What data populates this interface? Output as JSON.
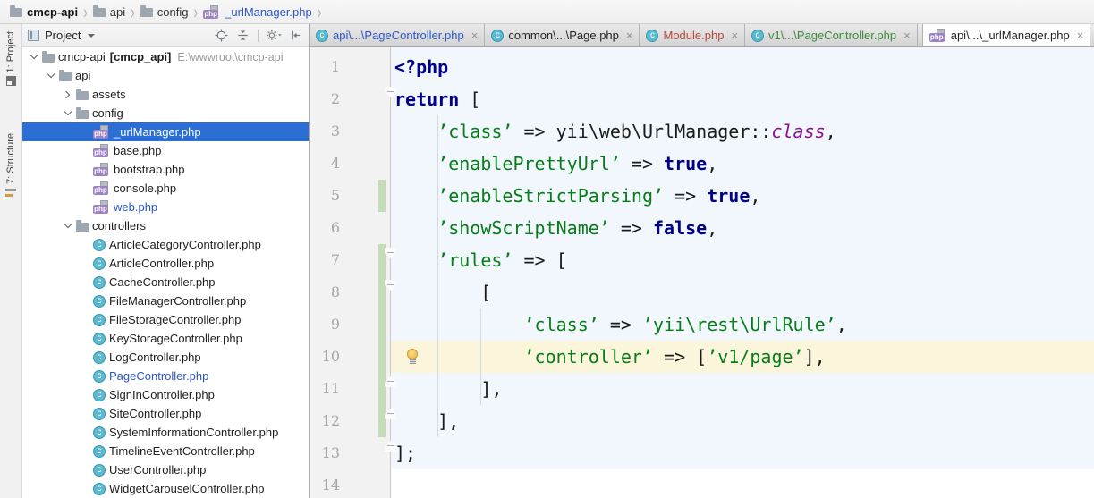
{
  "colors": {
    "selection_blue": "#2B6FD6",
    "modified_blue": "#2B55C8",
    "added_green": "#3F8A3F",
    "conflict_red": "#B5483C",
    "string_green": "#067D17",
    "keyword_navy": "#00008C",
    "class_purple": "#871094",
    "caret_row_yellow": "#FBF5DC",
    "editor_tint_blue": "#F1F7FD",
    "vcs_bar_green": "#C5DCB8"
  },
  "icons": {
    "php_badge": "php",
    "class_letter": "c",
    "close": "×"
  },
  "breadcrumbs": {
    "items": [
      {
        "label": "cmcp-api",
        "icon": "folder",
        "bold": true
      },
      {
        "label": "api",
        "icon": "folder"
      },
      {
        "label": "config",
        "icon": "folder"
      },
      {
        "label": "_urlManager.php",
        "icon": "php",
        "modified": true
      }
    ]
  },
  "tool_strip": {
    "project_label": "1: Project",
    "structure_label": "7: Structure"
  },
  "project_panel": {
    "title": "Project",
    "tree": [
      {
        "indent": 0,
        "chevron": "open",
        "icon": "folder",
        "label": "cmcp-api",
        "suffix_bold": "[cmcp_api]",
        "suffix_path": "E:\\wwwroot\\cmcp-api"
      },
      {
        "indent": 1,
        "chevron": "open",
        "icon": "folder",
        "label": "api"
      },
      {
        "indent": 2,
        "chevron": "closed",
        "icon": "folder",
        "label": "assets"
      },
      {
        "indent": 2,
        "chevron": "open",
        "icon": "folder",
        "label": "config"
      },
      {
        "indent": 3,
        "icon": "php",
        "label": "_urlManager.php",
        "selected": true
      },
      {
        "indent": 3,
        "icon": "php",
        "label": "base.php"
      },
      {
        "indent": 3,
        "icon": "php",
        "label": "bootstrap.php"
      },
      {
        "indent": 3,
        "icon": "php",
        "label": "console.php"
      },
      {
        "indent": 3,
        "icon": "php",
        "label": "web.php",
        "modified": true
      },
      {
        "indent": 2,
        "chevron": "open",
        "icon": "folder",
        "label": "controllers"
      },
      {
        "indent": 3,
        "icon": "class",
        "label": "ArticleCategoryController.php"
      },
      {
        "indent": 3,
        "icon": "class",
        "label": "ArticleController.php"
      },
      {
        "indent": 3,
        "icon": "class",
        "label": "CacheController.php"
      },
      {
        "indent": 3,
        "icon": "class",
        "label": "FileManagerController.php"
      },
      {
        "indent": 3,
        "icon": "class",
        "label": "FileStorageController.php"
      },
      {
        "indent": 3,
        "icon": "class",
        "label": "KeyStorageController.php"
      },
      {
        "indent": 3,
        "icon": "class",
        "label": "LogController.php"
      },
      {
        "indent": 3,
        "icon": "class",
        "label": "PageController.php",
        "modified": true
      },
      {
        "indent": 3,
        "icon": "class",
        "label": "SignInController.php"
      },
      {
        "indent": 3,
        "icon": "class",
        "label": "SiteController.php"
      },
      {
        "indent": 3,
        "icon": "class",
        "label": "SystemInformationController.php"
      },
      {
        "indent": 3,
        "icon": "class",
        "label": "TimelineEventController.php"
      },
      {
        "indent": 3,
        "icon": "class",
        "label": "UserController.php"
      },
      {
        "indent": 3,
        "icon": "class",
        "label": "WidgetCarouselController.php"
      }
    ]
  },
  "tabs": [
    {
      "label": "api\\...\\PageController.php",
      "icon": "class",
      "state": "modified"
    },
    {
      "label": "common\\...\\Page.php",
      "icon": "class",
      "state": "normal"
    },
    {
      "label": "Module.php",
      "icon": "class",
      "state": "conflict"
    },
    {
      "label": "v1\\...\\PageController.php",
      "icon": "class",
      "state": "added"
    },
    {
      "label": "api\\...\\_urlManager.php",
      "icon": "php",
      "state": "normal",
      "active": true
    }
  ],
  "editor": {
    "lines": [
      [
        [
          "k",
          "<?php"
        ]
      ],
      [
        [
          "k",
          "return"
        ],
        [
          "p",
          " ["
        ]
      ],
      [
        [
          "p",
          "    "
        ],
        [
          "s",
          "’class’"
        ],
        [
          "p",
          " => yii\\web\\UrlManager::"
        ],
        [
          "c",
          "class"
        ],
        [
          "p",
          ","
        ]
      ],
      [
        [
          "p",
          "    "
        ],
        [
          "s",
          "’enablePrettyUrl’"
        ],
        [
          "p",
          " => "
        ],
        [
          "k",
          "true"
        ],
        [
          "p",
          ","
        ]
      ],
      [
        [
          "p",
          "    "
        ],
        [
          "s",
          "’enableStrictParsing’"
        ],
        [
          "p",
          " => "
        ],
        [
          "k",
          "true"
        ],
        [
          "p",
          ","
        ]
      ],
      [
        [
          "p",
          "    "
        ],
        [
          "s",
          "’showScriptName’"
        ],
        [
          "p",
          " => "
        ],
        [
          "k",
          "false"
        ],
        [
          "p",
          ","
        ]
      ],
      [
        [
          "p",
          "    "
        ],
        [
          "s",
          "’rules’"
        ],
        [
          "p",
          " => ["
        ]
      ],
      [
        [
          "p",
          "        ["
        ]
      ],
      [
        [
          "p",
          "            "
        ],
        [
          "s",
          "’class’"
        ],
        [
          "p",
          " => "
        ],
        [
          "s",
          "’yii\\rest\\UrlRule’"
        ],
        [
          "p",
          ","
        ]
      ],
      [
        [
          "p",
          "            "
        ],
        [
          "s",
          "’controller’"
        ],
        [
          "p",
          " => ["
        ],
        [
          "s",
          "’v1/page’"
        ],
        [
          "p",
          "],"
        ]
      ],
      [
        [
          "p",
          "        ],"
        ]
      ],
      [
        [
          "p",
          "    ],"
        ]
      ],
      [
        [
          "p",
          "];"
        ]
      ],
      []
    ],
    "caret_line": 10,
    "bulb_line": 10,
    "tint_through_line": 13,
    "vcs_bars": [
      {
        "from": 5,
        "to": 5
      },
      {
        "from": 7,
        "to": 12
      }
    ],
    "fold_markers": [
      {
        "line": 2,
        "dir": "down"
      },
      {
        "line": 7,
        "dir": "down"
      },
      {
        "line": 8,
        "dir": "down"
      },
      {
        "line": 11,
        "dir": "up"
      },
      {
        "line": 12,
        "dir": "up"
      },
      {
        "line": 13,
        "dir": "up"
      }
    ],
    "indent_guides": [
      {
        "col": 4,
        "from": 3,
        "to": 12
      },
      {
        "col": 8,
        "from": 9,
        "to": 11
      }
    ]
  }
}
